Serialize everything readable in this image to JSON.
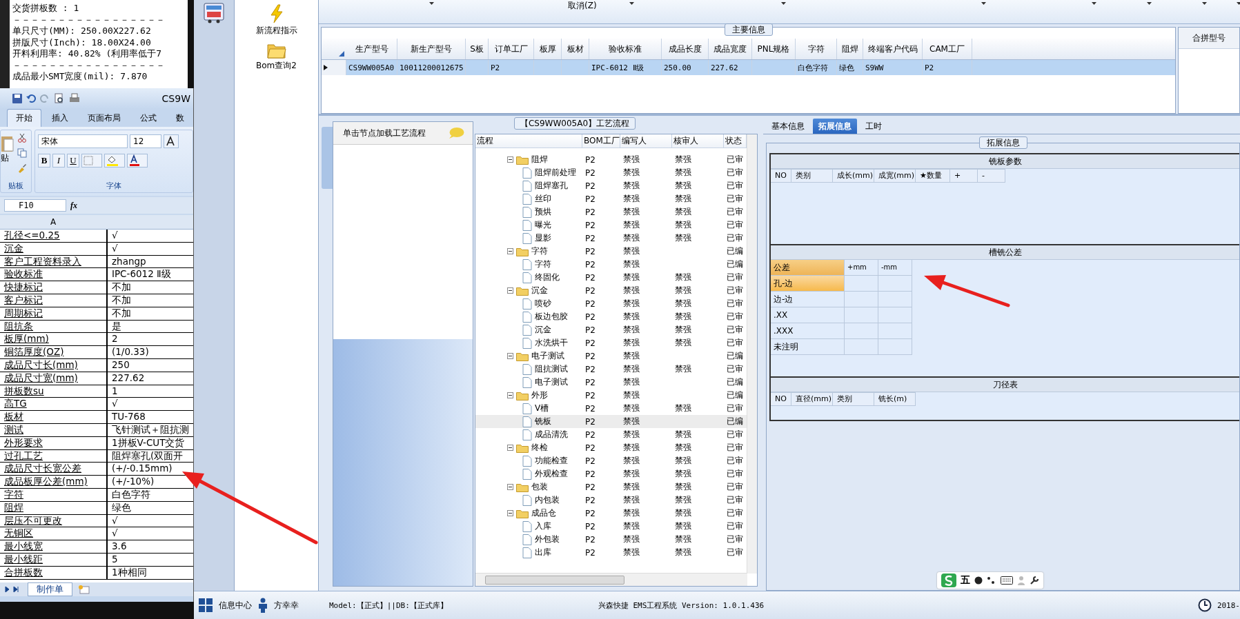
{
  "notepad": {
    "lines": [
      "交货拼板数 : 1",
      "－－－－－－－－－－－－－－－－－",
      "单只尺寸(MM): 250.00X227.62",
      "拼版尺寸(Inch): 18.00X24.00",
      "开料利用率: 40.82% (利用率低于7",
      "－－－－－－－－－－－－－－－－－",
      "成品最小SMT宽度(mil): 7.870"
    ]
  },
  "excel": {
    "title": "CS9W",
    "tabs": [
      {
        "label": "开始",
        "selected": true
      },
      {
        "label": "插入",
        "selected": false
      },
      {
        "label": "页面布局",
        "selected": false
      },
      {
        "label": "公式",
        "selected": false
      },
      {
        "label": "数",
        "selected": false
      }
    ],
    "paste_label": "贴",
    "clipboard_label": "贴板",
    "font": "宋体",
    "font_size": "12",
    "format_buttons": [
      "B",
      "I",
      "U"
    ],
    "font_group_label": "字体",
    "name_box": "F10",
    "formula_label": "fx",
    "column_header": "A",
    "rows": [
      {
        "label": "孔径<=0.25",
        "value": "√"
      },
      {
        "label": "沉金",
        "value": "√"
      },
      {
        "label": "客户工程资料录入",
        "value": "zhangp"
      },
      {
        "label": "验收标准",
        "value": "IPC-6012 Ⅱ级"
      },
      {
        "label": "快捷标记",
        "value": "不加"
      },
      {
        "label": "客户标记",
        "value": "不加"
      },
      {
        "label": "周期标记",
        "value": "不加"
      },
      {
        "label": "阻抗条",
        "value": "是"
      },
      {
        "label": "板厚(mm)",
        "value": "2"
      },
      {
        "label": "铜箔厚度(OZ)",
        "value": "(1/0.33)"
      },
      {
        "label": "成品尺寸长(mm)",
        "value": "250"
      },
      {
        "label": "成品尺寸宽(mm)",
        "value": "227.62"
      },
      {
        "label": "拼板数su",
        "value": "1"
      },
      {
        "label": "高TG",
        "value": "√"
      },
      {
        "label": "板材",
        "value": "TU-768"
      },
      {
        "label": "测试",
        "value": "飞针测试＋阻抗测"
      },
      {
        "label": "外形要求",
        "value": "1拼板V-CUT交货"
      },
      {
        "label": "过孔工艺",
        "value": "阻焊塞孔(双面开"
      },
      {
        "label": "成品尺寸长宽公差",
        "value": "(+/-0.15mm)"
      },
      {
        "label": "成品板厚公差(mm)",
        "value": "(+/-10%)"
      },
      {
        "label": "字符",
        "value": "白色字符"
      },
      {
        "label": "阻焊",
        "value": "绿色"
      },
      {
        "label": "层压不可更改",
        "value": "√"
      },
      {
        "label": "无铜区",
        "value": "√"
      },
      {
        "label": "最小线宽",
        "value": "3.6"
      },
      {
        "label": "最小线距",
        "value": "5"
      },
      {
        "label": "合拼板数",
        "value": "1种相同"
      }
    ],
    "sheet_tab": "制作单"
  },
  "launcher": {
    "items": [
      {
        "kind": "bolt",
        "label": "新流程指示"
      },
      {
        "kind": "folder",
        "label": "Bom查询2"
      }
    ]
  },
  "toolbar": {
    "cancel": "取消(Z)"
  },
  "main_info": {
    "title": "主要信息",
    "side_title": "合拼型号",
    "columns": [
      "生产型号",
      "新生产型号",
      "S板",
      "订单工厂",
      "板厚",
      "板材",
      "验收标准",
      "成品长度",
      "成品宽度",
      "PNL规格",
      "字符",
      "阻焊",
      "终端客户代码",
      "CAM工厂"
    ],
    "rows": [
      {
        "selected": true,
        "cells": [
          "CS9WW005A0",
          "10011200012675",
          null,
          "P2",
          null,
          null,
          "IPC-6012 Ⅱ级",
          "250.00",
          "227.62",
          null,
          "白色字符",
          "绿色",
          "S9WW",
          "P2"
        ]
      }
    ]
  },
  "flow": {
    "hint": "单击节点加载工艺流程",
    "title": "【CS9WW005A0】工艺流程",
    "columns": [
      "流程",
      "BOM工厂",
      "编写人",
      "核审人",
      "状态"
    ],
    "tree": [
      {
        "name": "阻焊",
        "bom": "P2",
        "writer": "禁强",
        "reviewer": "禁强",
        "status": "已审",
        "expanded": true,
        "selected": false,
        "children": [
          {
            "name": "阻焊前处理",
            "bom": "P2",
            "writer": "禁强",
            "reviewer": "禁强",
            "status": "已审",
            "selected": false
          },
          {
            "name": "阻焊塞孔",
            "bom": "P2",
            "writer": "禁强",
            "reviewer": "禁强",
            "status": "已审",
            "selected": false
          },
          {
            "name": "丝印",
            "bom": "P2",
            "writer": "禁强",
            "reviewer": "禁强",
            "status": "已审",
            "selected": false
          },
          {
            "name": "预烘",
            "bom": "P2",
            "writer": "禁强",
            "reviewer": "禁强",
            "status": "已审",
            "selected": false
          },
          {
            "name": "曝光",
            "bom": "P2",
            "writer": "禁强",
            "reviewer": "禁强",
            "status": "已审",
            "selected": false
          },
          {
            "name": "显影",
            "bom": "P2",
            "writer": "禁强",
            "reviewer": "禁强",
            "status": "已审",
            "selected": false
          }
        ]
      },
      {
        "name": "字符",
        "bom": "P2",
        "writer": "禁强",
        "status": "已编",
        "expanded": true,
        "selected": false,
        "children": [
          {
            "name": "字符",
            "bom": "P2",
            "writer": "禁强",
            "status": "已编",
            "selected": false
          },
          {
            "name": "终固化",
            "bom": "P2",
            "writer": "禁强",
            "reviewer": "禁强",
            "status": "已审",
            "selected": false
          }
        ]
      },
      {
        "name": "沉金",
        "bom": "P2",
        "writer": "禁强",
        "reviewer": "禁强",
        "status": "已审",
        "expanded": true,
        "selected": false,
        "children": [
          {
            "name": "喷砂",
            "bom": "P2",
            "writer": "禁强",
            "reviewer": "禁强",
            "status": "已审",
            "selected": false
          },
          {
            "name": "板边包胶",
            "bom": "P2",
            "writer": "禁强",
            "reviewer": "禁强",
            "status": "已审",
            "selected": false
          },
          {
            "name": "沉金",
            "bom": "P2",
            "writer": "禁强",
            "reviewer": "禁强",
            "status": "已审",
            "selected": false
          },
          {
            "name": "水洗烘干",
            "bom": "P2",
            "writer": "禁强",
            "reviewer": "禁强",
            "status": "已审",
            "selected": false
          }
        ]
      },
      {
        "name": "电子测试",
        "bom": "P2",
        "writer": "禁强",
        "status": "已编",
        "expanded": true,
        "selected": false,
        "children": [
          {
            "name": "阻抗测试",
            "bom": "P2",
            "writer": "禁强",
            "reviewer": "禁强",
            "status": "已审",
            "selected": false
          },
          {
            "name": "电子测试",
            "bom": "P2",
            "writer": "禁强",
            "status": "已编",
            "selected": false
          }
        ]
      },
      {
        "name": "外形",
        "bom": "P2",
        "writer": "禁强",
        "status": "已编",
        "expanded": true,
        "selected": false,
        "children": [
          {
            "name": "V槽",
            "bom": "P2",
            "writer": "禁强",
            "reviewer": "禁强",
            "status": "已审",
            "selected": false
          },
          {
            "name": "铣板",
            "bom": "P2",
            "writer": "禁强",
            "status": "已编",
            "selected": true
          },
          {
            "name": "成品清洗",
            "bom": "P2",
            "writer": "禁强",
            "reviewer": "禁强",
            "status": "已审",
            "selected": false
          }
        ]
      },
      {
        "name": "终检",
        "bom": "P2",
        "writer": "禁强",
        "reviewer": "禁强",
        "status": "已审",
        "expanded": true,
        "selected": false,
        "children": [
          {
            "name": "功能检查",
            "bom": "P2",
            "writer": "禁强",
            "reviewer": "禁强",
            "status": "已审",
            "selected": false
          },
          {
            "name": "外观检查",
            "bom": "P2",
            "writer": "禁强",
            "reviewer": "禁强",
            "status": "已审",
            "selected": false
          }
        ]
      },
      {
        "name": "包装",
        "bom": "P2",
        "writer": "禁强",
        "reviewer": "禁强",
        "status": "已审",
        "expanded": true,
        "selected": false,
        "children": [
          {
            "name": "内包装",
            "bom": "P2",
            "writer": "禁强",
            "reviewer": "禁强",
            "status": "已审",
            "selected": false
          }
        ]
      },
      {
        "name": "成品仓",
        "bom": "P2",
        "writer": "禁强",
        "reviewer": "禁强",
        "status": "已审",
        "expanded": true,
        "selected": false,
        "children": [
          {
            "name": "入库",
            "bom": "P2",
            "writer": "禁强",
            "reviewer": "禁强",
            "status": "已审",
            "selected": false
          },
          {
            "name": "外包装",
            "bom": "P2",
            "writer": "禁强",
            "reviewer": "禁强",
            "status": "已审",
            "selected": false
          },
          {
            "name": "出库",
            "bom": "P2",
            "writer": "禁强",
            "reviewer": "禁强",
            "status": "已审",
            "selected": false
          }
        ]
      }
    ]
  },
  "detail": {
    "tabs": [
      {
        "label": "基本信息",
        "selected": false
      },
      {
        "label": "拓展信息",
        "selected": true
      },
      {
        "label": "工时",
        "selected": false
      }
    ],
    "group_title": "拓展信息",
    "sections": [
      {
        "kind": "grid",
        "title": "铣板参数",
        "columns": [
          "NO",
          "类别",
          "成长(mm)",
          "成宽(mm)",
          "★数量",
          "+",
          "-"
        ]
      },
      {
        "kind": "tolerance",
        "title": "槽铣公差",
        "columns": [
          "公差",
          "+mm",
          "-mm"
        ],
        "rows": [
          {
            "label": "孔-边",
            "selected": true
          },
          {
            "label": "边-边",
            "selected": false
          },
          {
            "label": ".XX",
            "selected": false
          },
          {
            "label": ".XXX",
            "selected": false
          },
          {
            "label": "未注明",
            "selected": false
          }
        ]
      },
      {
        "kind": "grid",
        "title": "刀径表",
        "columns": [
          "NO",
          "直径(mm)",
          "类别",
          "铣长(m)"
        ]
      }
    ]
  },
  "ime": {
    "label": "五"
  },
  "status_bar": {
    "info_center": "信息中心",
    "user": "方幸幸",
    "environment": "Model:【正式】||DB:【正式库】",
    "app_version": "兴森快捷 EMS工程系统 Version: 1.0.1.436",
    "date": "2018-"
  }
}
